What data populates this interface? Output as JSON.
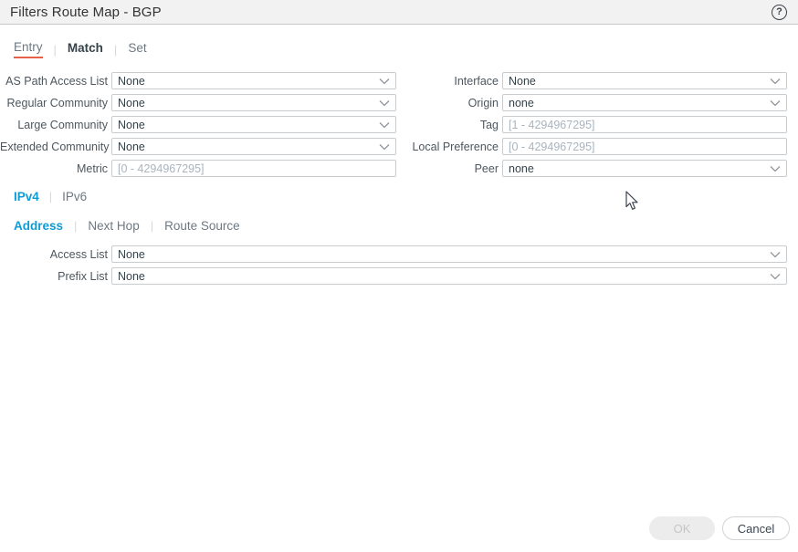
{
  "dialog": {
    "title": "Filters Route Map - BGP"
  },
  "icons": {
    "help": "?"
  },
  "tabs": [
    {
      "label": "Entry"
    },
    {
      "label": "Match"
    },
    {
      "label": "Set"
    }
  ],
  "match_form": {
    "left": [
      {
        "label": "AS Path Access List",
        "type": "select",
        "value": "None"
      },
      {
        "label": "Regular Community",
        "type": "select",
        "value": "None"
      },
      {
        "label": "Large Community",
        "type": "select",
        "value": "None"
      },
      {
        "label": "Extended Community",
        "type": "select",
        "value": "None"
      },
      {
        "label": "Metric",
        "type": "input",
        "placeholder": "[0 - 4294967295]"
      }
    ],
    "right": [
      {
        "label": "Interface",
        "type": "select",
        "value": "None"
      },
      {
        "label": "Origin",
        "type": "select",
        "value": "none"
      },
      {
        "label": "Tag",
        "type": "input",
        "placeholder": "[1 - 4294967295]"
      },
      {
        "label": "Local Preference",
        "type": "input",
        "placeholder": "[0 - 4294967295]"
      },
      {
        "label": "Peer",
        "type": "select",
        "value": "none"
      }
    ]
  },
  "ip_tabs": [
    {
      "label": "IPv4",
      "active": true
    },
    {
      "label": "IPv6",
      "active": false
    }
  ],
  "sub_tabs": [
    {
      "label": "Address",
      "active": true
    },
    {
      "label": "Next Hop",
      "active": false
    },
    {
      "label": "Route Source",
      "active": false
    }
  ],
  "address_form": [
    {
      "label": "Access List",
      "type": "select",
      "value": "None"
    },
    {
      "label": "Prefix List",
      "type": "select",
      "value": "None"
    }
  ],
  "footer": {
    "ok_label": "OK",
    "cancel_label": "Cancel"
  },
  "colors": {
    "accent_blue": "#0e9cd6",
    "tab_underline_red": "#e8604c",
    "header_bg": "#f2f2f2",
    "field_border": "#c8ccce",
    "placeholder": "#a9b4be",
    "disabled_button_bg": "#ececec"
  }
}
